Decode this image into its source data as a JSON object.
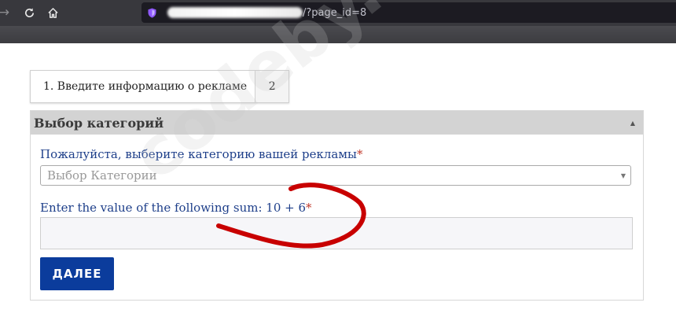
{
  "browser": {
    "url_path": "/?page_id=8",
    "icons": {
      "back": "arrow-left-icon",
      "reload": "reload-icon",
      "home": "home-icon",
      "shield": "shield-icon"
    }
  },
  "steps": {
    "current": "1.  Введите информацию о рекламе",
    "next": "2"
  },
  "panel": {
    "title": "Выбор категорий",
    "collapse_icon": "chevron-up-icon",
    "category_label": "Пожалуйста, выберите категорию вашей рекламы",
    "category_placeholder": "Выбор Категории",
    "sum_label": "Enter the value of the following sum: 10 + 6",
    "required_mark": "*",
    "sum_value": "",
    "next_button": "ДАЛЕЕ"
  },
  "watermark": "codeby.net",
  "colors": {
    "accent": "#0b3c9c",
    "label": "#1e3f8a",
    "required": "#c0392b",
    "header_bg": "#d3d3d3",
    "scribble": "#c80000"
  }
}
